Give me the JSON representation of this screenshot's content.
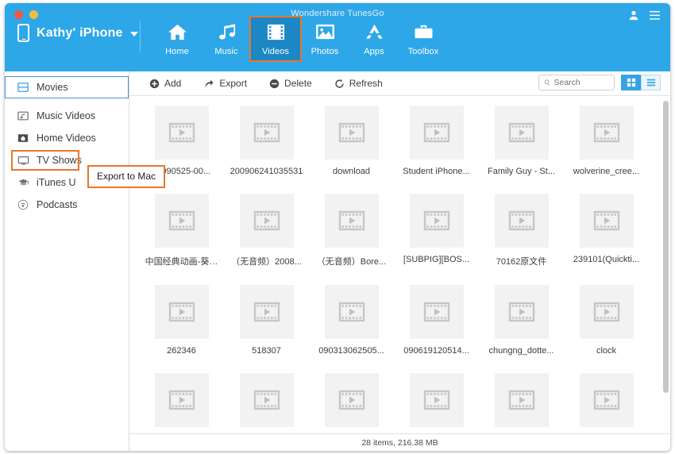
{
  "window": {
    "app_title": "Wondershare TunesGo",
    "traffic_lights": [
      "close-red",
      "minimize-yellow"
    ]
  },
  "header": {
    "device": {
      "icon": "iphone-icon",
      "name": "Kathy' iPhone",
      "caret": "chevron-down-icon"
    },
    "account_icon": "user-icon",
    "menu_icon": "hamburger-menu-icon",
    "nav": [
      {
        "label": "Home",
        "icon": "home-icon",
        "active": false
      },
      {
        "label": "Music",
        "icon": "music-note-icon",
        "active": false
      },
      {
        "label": "Videos",
        "icon": "film-icon",
        "active": true
      },
      {
        "label": "Photos",
        "icon": "photo-icon",
        "active": false
      },
      {
        "label": "Apps",
        "icon": "app-store-icon",
        "active": false
      },
      {
        "label": "Toolbox",
        "icon": "briefcase-icon",
        "active": false
      }
    ]
  },
  "sidebar": {
    "items": [
      {
        "label": "Movies",
        "icon": "movies-icon",
        "selected": true
      },
      {
        "label": "Music Videos",
        "icon": "music-video-icon",
        "selected": false
      },
      {
        "label": "Home Videos",
        "icon": "home-video-icon",
        "selected": false
      },
      {
        "label": "TV Shows",
        "icon": "tv-icon",
        "selected": false
      },
      {
        "label": "iTunes U",
        "icon": "graduation-cap-icon",
        "selected": false
      },
      {
        "label": "Podcasts",
        "icon": "podcast-icon",
        "selected": false
      }
    ]
  },
  "tooltip": {
    "text": "Export to Mac",
    "accent_color": "#e8762a"
  },
  "toolbar": {
    "buttons": [
      {
        "label": "Add",
        "icon": "plus-circle-icon"
      },
      {
        "label": "Export",
        "icon": "export-arrow-icon"
      },
      {
        "label": "Delete",
        "icon": "minus-circle-icon"
      },
      {
        "label": "Refresh",
        "icon": "refresh-icon"
      }
    ],
    "search": {
      "placeholder": "Search",
      "value": "",
      "icon": "search-icon"
    },
    "view_toggle": [
      {
        "name": "grid-view",
        "icon": "grid-view-icon",
        "active": true
      },
      {
        "name": "list-view",
        "icon": "list-view-icon",
        "active": false
      }
    ]
  },
  "content": {
    "items": [
      {
        "caption": "(C090525-00..."
      },
      {
        "caption": "200906241035531"
      },
      {
        "caption": "download"
      },
      {
        "caption": "Student iPhone..."
      },
      {
        "caption": "Family Guy - St..."
      },
      {
        "caption": "wolverine_cree..."
      },
      {
        "caption": "中国经典动画-葵…"
      },
      {
        "caption": "（无音频）2008..."
      },
      {
        "caption": "（无音频）Bore..."
      },
      {
        "caption": "[SUBPIG][BOS..."
      },
      {
        "caption": "70162原文件"
      },
      {
        "caption": "239101(Quickti..."
      },
      {
        "caption": "262346"
      },
      {
        "caption": "518307"
      },
      {
        "caption": "090313062505..."
      },
      {
        "caption": "090619120514..."
      },
      {
        "caption": "chungng_dotte..."
      },
      {
        "caption": "clock"
      },
      {
        "caption": ""
      },
      {
        "caption": ""
      },
      {
        "caption": ""
      },
      {
        "caption": ""
      },
      {
        "caption": ""
      },
      {
        "caption": ""
      }
    ],
    "thumbnail_icon": "video-film-placeholder-icon"
  },
  "statusbar": {
    "text": "28 items, 216.38 MB"
  },
  "colors": {
    "header_blue": "#2da7e8",
    "active_nav_blue": "#1c87c4",
    "accent_orange": "#e8762a",
    "selection_blue": "#4a90d9",
    "toggle_blue": "#35a3e3"
  }
}
